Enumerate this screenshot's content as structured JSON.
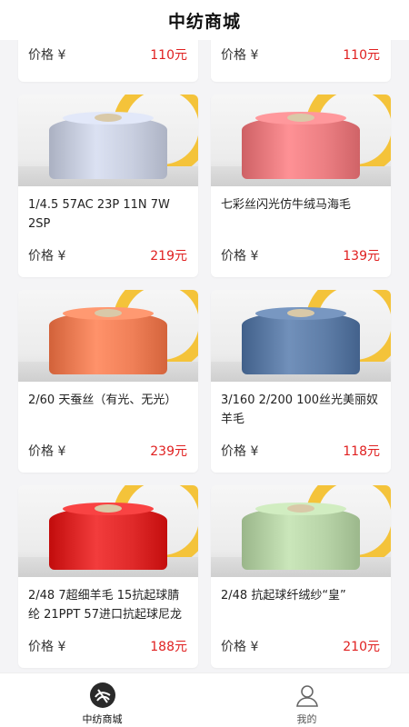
{
  "header": {
    "title": "中纺商城"
  },
  "colors": {
    "price": "#e02020",
    "ring": "#f4c33a"
  },
  "products": [
    {
      "title": "",
      "price_label": "价格 ¥",
      "price": "110元",
      "yarn_color": "",
      "partial": true
    },
    {
      "title": "",
      "price_label": "价格 ¥",
      "price": "110元",
      "yarn_color": "",
      "partial": true
    },
    {
      "title": "1/4.5 57AC 23P 11N 7W 2SP",
      "price_label": "价格 ¥",
      "price": "219元",
      "yarn_color": "#c9cfe0"
    },
    {
      "title": "七彩丝闪光仿牛绒马海毛",
      "price_label": "价格 ¥",
      "price": "139元",
      "yarn_color": "#ec7f83"
    },
    {
      "title": "2/60 天蚕丝（有光、无光）",
      "price_label": "价格 ¥",
      "price": "239元",
      "yarn_color": "#f08058"
    },
    {
      "title": "3/160 2/200 100丝光美丽奴羊毛",
      "price_label": "价格 ¥",
      "price": "118元",
      "yarn_color": "#5f7ea8"
    },
    {
      "title": "2/48 7超细羊毛 15抗起球腈纶 21PPT 57进口抗起球尼龙",
      "price_label": "价格 ¥",
      "price": "188元",
      "yarn_color": "#e02a2a"
    },
    {
      "title": "2/48 抗起球纤绒纱“皇”",
      "price_label": "价格 ¥",
      "price": "210元",
      "yarn_color": "#b8d4a8"
    }
  ],
  "tabbar": {
    "items": [
      {
        "label": "中纺商城",
        "icon": "mall-logo-icon",
        "active": true
      },
      {
        "label": "我的",
        "icon": "user-icon",
        "active": false
      }
    ]
  }
}
